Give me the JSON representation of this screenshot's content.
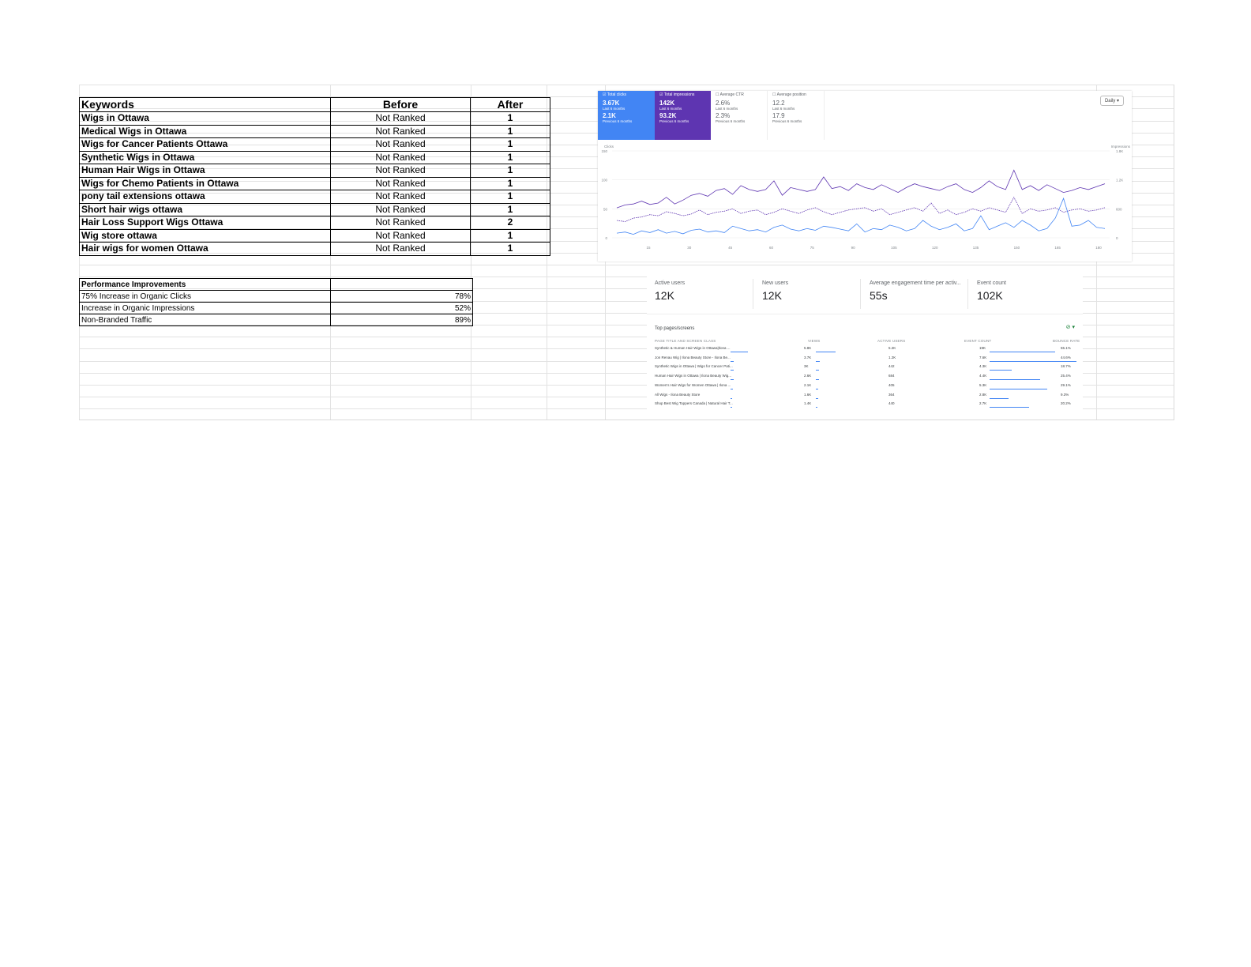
{
  "keywords_table": {
    "headers": {
      "keyword": "Keywords",
      "before": "Before",
      "after": "After"
    },
    "rows": [
      {
        "keyword": "Wigs in Ottawa",
        "before": "Not Ranked",
        "after": "1"
      },
      {
        "keyword": "Medical Wigs in Ottawa",
        "before": "Not Ranked",
        "after": "1"
      },
      {
        "keyword": "Wigs for Cancer Patients Ottawa",
        "before": "Not Ranked",
        "after": "1"
      },
      {
        "keyword": "Synthetic Wigs in Ottawa",
        "before": "Not Ranked",
        "after": "1"
      },
      {
        "keyword": "Human Hair Wigs in Ottawa",
        "before": "Not Ranked",
        "after": "1"
      },
      {
        "keyword": "Wigs for Chemo Patients in Ottawa",
        "before": "Not Ranked",
        "after": "1"
      },
      {
        "keyword": "pony tail extensions ottawa",
        "before": "Not Ranked",
        "after": "1"
      },
      {
        "keyword": "Short hair wigs ottawa",
        "before": "Not Ranked",
        "after": "1"
      },
      {
        "keyword": "Hair Loss Support Wigs Ottawa",
        "before": "Not Ranked",
        "after": "2"
      },
      {
        "keyword": "Wig store ottawa",
        "before": "Not Ranked",
        "after": "1"
      },
      {
        "keyword": "Hair wigs for women Ottawa",
        "before": "Not Ranked",
        "after": "1"
      }
    ]
  },
  "performance_table": {
    "title": "Performance Improvements",
    "rows": [
      {
        "label": "75% Increase in Organic Clicks",
        "value": "78%"
      },
      {
        "label": "Increase in Organic Impressions",
        "value": "52%"
      },
      {
        "label": "Non-Branded Traffic",
        "value": "89%"
      }
    ]
  },
  "gsc": {
    "cards": {
      "clicks": {
        "label": "Total clicks",
        "value": "3.67K",
        "period": "Last 6 months",
        "prev_value": "2.1K",
        "prev_period": "Previous 6 months"
      },
      "impressions": {
        "label": "Total impressions",
        "value": "142K",
        "period": "Last 6 months",
        "prev_value": "93.2K",
        "prev_period": "Previous 6 months"
      },
      "ctr": {
        "label": "Average CTR",
        "value": "2.6%",
        "period": "Last 6 months",
        "prev_value": "2.3%",
        "prev_period": "Previous 6 months"
      },
      "position": {
        "label": "Average position",
        "value": "12.2",
        "period": "Last 6 months",
        "prev_value": "17.9",
        "prev_period": "Previous 6 months"
      }
    },
    "daily_label": "Daily",
    "colors": {
      "clicks": "#4285f4",
      "impressions": "#5e35b1"
    }
  },
  "chart_data": {
    "type": "line",
    "ylabel": "Clicks",
    "y2label": "Impressions",
    "ylim": [
      0,
      150
    ],
    "y_ticks": [
      "150",
      "100",
      "50",
      "0"
    ],
    "y2lim": [
      0,
      1800
    ],
    "y2_ticks": [
      "1.8K",
      "1.2K",
      "600",
      "0"
    ],
    "x_ticks": [
      "15",
      "30",
      "45",
      "60",
      "75",
      "90",
      "105",
      "120",
      "135",
      "150",
      "165",
      "180"
    ],
    "series": [
      {
        "name": "Total impressions",
        "axis": "right",
        "style": "solid",
        "values": [
          620,
          680,
          700,
          760,
          690,
          720,
          840,
          700,
          780,
          880,
          920,
          860,
          980,
          1020,
          900,
          1080,
          1000,
          960,
          1000,
          1180,
          880,
          1040,
          1000,
          960,
          1000,
          1260,
          1020,
          1060,
          980,
          1120,
          1040,
          1000,
          1100,
          1020,
          940,
          1040,
          1120,
          1060,
          1020,
          980,
          1060,
          1120,
          1000,
          940,
          1040,
          1180,
          1060,
          1000,
          1400,
          1000,
          1080,
          980,
          1100,
          1020,
          940,
          980,
          1040,
          1000,
          1060,
          1120
        ]
      },
      {
        "name": "Total clicks (previous)",
        "axis": "left",
        "style": "dashed",
        "values": [
          30,
          28,
          34,
          36,
          40,
          38,
          45,
          42,
          38,
          41,
          48,
          40,
          44,
          46,
          50,
          42,
          46,
          48,
          40,
          44,
          50,
          46,
          42,
          48,
          52,
          45,
          40,
          44,
          48,
          50,
          52,
          46,
          50,
          40,
          44,
          48,
          52,
          46,
          60,
          42,
          48,
          40,
          44,
          50,
          46,
          52,
          48,
          44,
          70,
          42,
          50,
          46,
          48,
          52,
          44,
          48,
          50,
          46,
          48,
          52
        ]
      },
      {
        "name": "Total clicks",
        "axis": "left",
        "style": "solid",
        "values": [
          8,
          10,
          6,
          12,
          9,
          14,
          8,
          11,
          7,
          13,
          15,
          10,
          12,
          9,
          20,
          16,
          12,
          14,
          10,
          18,
          22,
          15,
          12,
          16,
          13,
          20,
          18,
          15,
          12,
          24,
          10,
          16,
          14,
          22,
          18,
          12,
          16,
          30,
          20,
          14,
          18,
          24,
          12,
          16,
          38,
          14,
          20,
          26,
          18,
          30,
          22,
          12,
          16,
          34,
          68,
          20,
          22,
          30,
          18,
          16
        ]
      }
    ]
  },
  "ga": {
    "metrics": [
      {
        "label": "Active users",
        "value": "12K"
      },
      {
        "label": "New users",
        "value": "12K"
      },
      {
        "label": "Average engagement time per activ...",
        "value": "55s"
      },
      {
        "label": "Event count",
        "value": "102K"
      }
    ],
    "table_title": "Top pages/screens",
    "columns": [
      "PAGE TITLE AND SCREEN CLASS",
      "VIEWS",
      "ACTIVE USERS",
      "EVENT COUNT",
      "BOUNCE RATE"
    ],
    "rows": [
      {
        "title": "Synthetic & Human Hair Wigs in Ottawa|Ilona ...",
        "views": "5.8K",
        "views_frac": 0.28,
        "users": "5.2K",
        "users_frac": 0.25,
        "events": "19K",
        "events_frac": 0.75,
        "bounce": "55.1%",
        "bounce_frac": 0.55
      },
      {
        "title": "Jon Renau Wig | Ilona Beauty Store - Ilona Be...",
        "views": "3.7K",
        "views_frac": 0.05,
        "users": "1.2K",
        "users_frac": 0.05,
        "events": "7.6K",
        "events_frac": 1.0,
        "bounce": "44.6%",
        "bounce_frac": 0.45
      },
      {
        "title": "Synthetic Wigs in Ottawa | Wigs for Cancer Pati...",
        "views": "3K",
        "views_frac": 0.05,
        "users": "442",
        "users_frac": 0.04,
        "events": "4.3K",
        "events_frac": 0.25,
        "bounce": "18.7%",
        "bounce_frac": 0.19
      },
      {
        "title": "Human Hair Wigs in Ottawa | Ilona Beauty Wig...",
        "views": "2.6K",
        "views_frac": 0.05,
        "users": "684",
        "users_frac": 0.04,
        "events": "4.4K",
        "events_frac": 0.58,
        "bounce": "25.4%",
        "bounce_frac": 0.25
      },
      {
        "title": "Women's Hair Wigs for Women Ottawa | Ilona ...",
        "views": "2.1K",
        "views_frac": 0.04,
        "users": "405",
        "users_frac": 0.03,
        "events": "5.3K",
        "events_frac": 0.66,
        "bounce": "29.1%",
        "bounce_frac": 0.29
      },
      {
        "title": "All Wigs - Ilona Beauty Store",
        "views": "1.6K",
        "views_frac": 0.03,
        "users": "364",
        "users_frac": 0.03,
        "events": "2.8K",
        "events_frac": 0.22,
        "bounce": "9.3%",
        "bounce_frac": 0.09
      },
      {
        "title": "Shop Best Wig Toppers Canada | Natural Hair T...",
        "views": "1.4K",
        "views_frac": 0.02,
        "users": "440",
        "users_frac": 0.02,
        "events": "2.7K",
        "events_frac": 0.45,
        "bounce": "20.2%",
        "bounce_frac": 0.2
      }
    ],
    "accent": "#4285f4"
  }
}
